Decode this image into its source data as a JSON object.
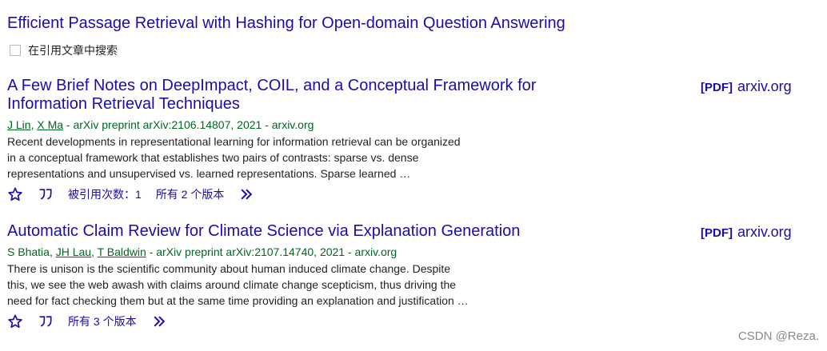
{
  "main_title": "Efficient Passage Retrieval with Hashing for Open-domain Question Answering",
  "search_within_label": "在引用文章中搜索",
  "results": [
    {
      "title_line1": "A Few Brief Notes on DeepImpact, COIL, and a Conceptual Framework for",
      "title_line2": "Information Retrieval Techniques",
      "pdf_tag": "[PDF]",
      "source": "arxiv.org",
      "authors": [
        "J Lin",
        "X Ma"
      ],
      "author_sep": ", ",
      "venue": " - arXiv preprint arXiv:2106.14807, 2021 - arxiv.org",
      "snippet": [
        "Recent developments in representational learning for information retrieval can be organized",
        "in a conceptual framework that establishes two pairs of contrasts: sparse vs. dense",
        "representations and unsupervised vs. learned representations. Sparse learned …"
      ],
      "cited_by": "被引用次数：1",
      "versions": "所有 2 个版本"
    },
    {
      "title_line1": "Automatic Claim Review for Climate Science via Explanation Generation",
      "pdf_tag": "[PDF]",
      "source": "arxiv.org",
      "author_plain": "S Bhatia",
      "authors": [
        "JH Lau",
        "T Baldwin"
      ],
      "author_sep": ", ",
      "venue": " - arXiv preprint arXiv:2107.14740, 2021 - arxiv.org",
      "snippet": [
        "There is unison is the scientific community about human induced climate change. Despite",
        "this, we see the web awash with claims around climate change scepticism, thus driving the",
        "need for fact checking them but at the same time providing an explanation and justification …"
      ],
      "versions": "所有 3 个版本"
    }
  ],
  "watermark": "CSDN @Reza.",
  "icons": {
    "save": "star-icon",
    "cite": "quote-icon",
    "related": "double-chevron-right-icon"
  },
  "colors": {
    "link": "#1a0dab",
    "meta": "#006621",
    "text": "#222222",
    "watermark": "#888888"
  }
}
